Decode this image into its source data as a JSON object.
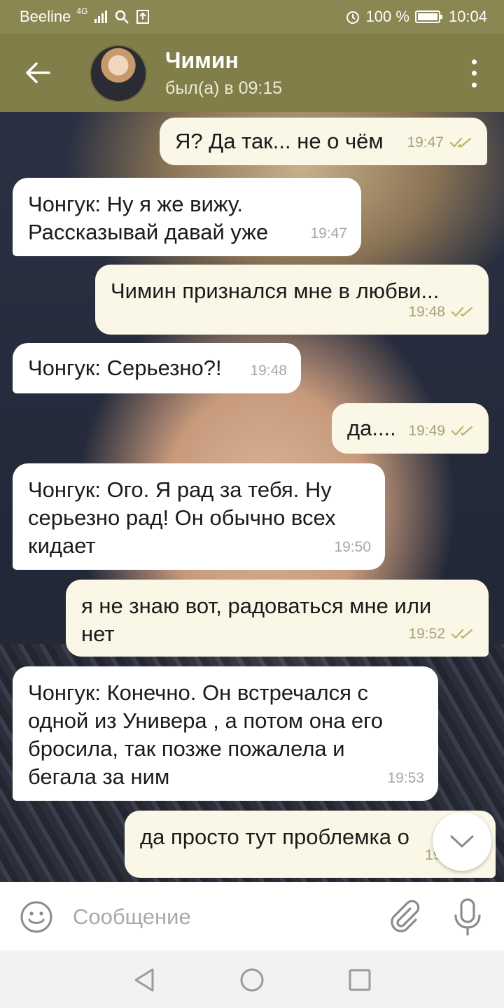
{
  "status_bar": {
    "carrier": "Beeline",
    "network": "4G",
    "battery": "100 %",
    "time": "10:04"
  },
  "header": {
    "contact_name": "Чимин",
    "last_seen": "был(а) в 09:15"
  },
  "messages": [
    {
      "direction": "out",
      "text": "Я? Да так... не о чём",
      "time": "19:47",
      "read": true
    },
    {
      "direction": "in",
      "text": "Чонгук: Ну я же вижу.\nРассказывай давай уже",
      "time": "19:47"
    },
    {
      "direction": "out",
      "text": "Чимин признался мне в любви...",
      "time": "19:48",
      "read": true
    },
    {
      "direction": "in",
      "text": "Чонгук: Серьезно?!",
      "time": "19:48"
    },
    {
      "direction": "out",
      "text": "да....",
      "time": "19:49",
      "read": true
    },
    {
      "direction": "in",
      "text": "Чонгук: Ого. Я рад за тебя. Ну\nсерьезно рад! Он обычно всех\nкидает",
      "time": "19:50"
    },
    {
      "direction": "out",
      "text": "я не знаю вот, радоваться мне или\nнет",
      "time": "19:52",
      "read": true
    },
    {
      "direction": "in",
      "text": "Чонгук: Конечно. Он встречался с\nодной из Универа , а потом она его\nбросила, так позже пожалела и\nбегала за ним",
      "time": "19:53"
    },
    {
      "direction": "out",
      "text": "да просто тут проблемка о",
      "time": "19:5",
      "read": true
    }
  ],
  "composer": {
    "placeholder": "Сообщение"
  },
  "icons": {
    "back": "arrow-left-icon",
    "more": "more-vertical-icon",
    "emoji": "emoji-icon",
    "attach": "paperclip-icon",
    "mic": "microphone-icon",
    "scroll_down": "chevron-down-icon",
    "nav_back": "triangle-back-icon",
    "nav_home": "circle-home-icon",
    "nav_recents": "square-recents-icon"
  },
  "colors": {
    "header": "#817e4a",
    "outgoing_bubble": "#fbf7e7",
    "incoming_bubble": "#ffffff",
    "read_ticks": "#b7b46a"
  }
}
